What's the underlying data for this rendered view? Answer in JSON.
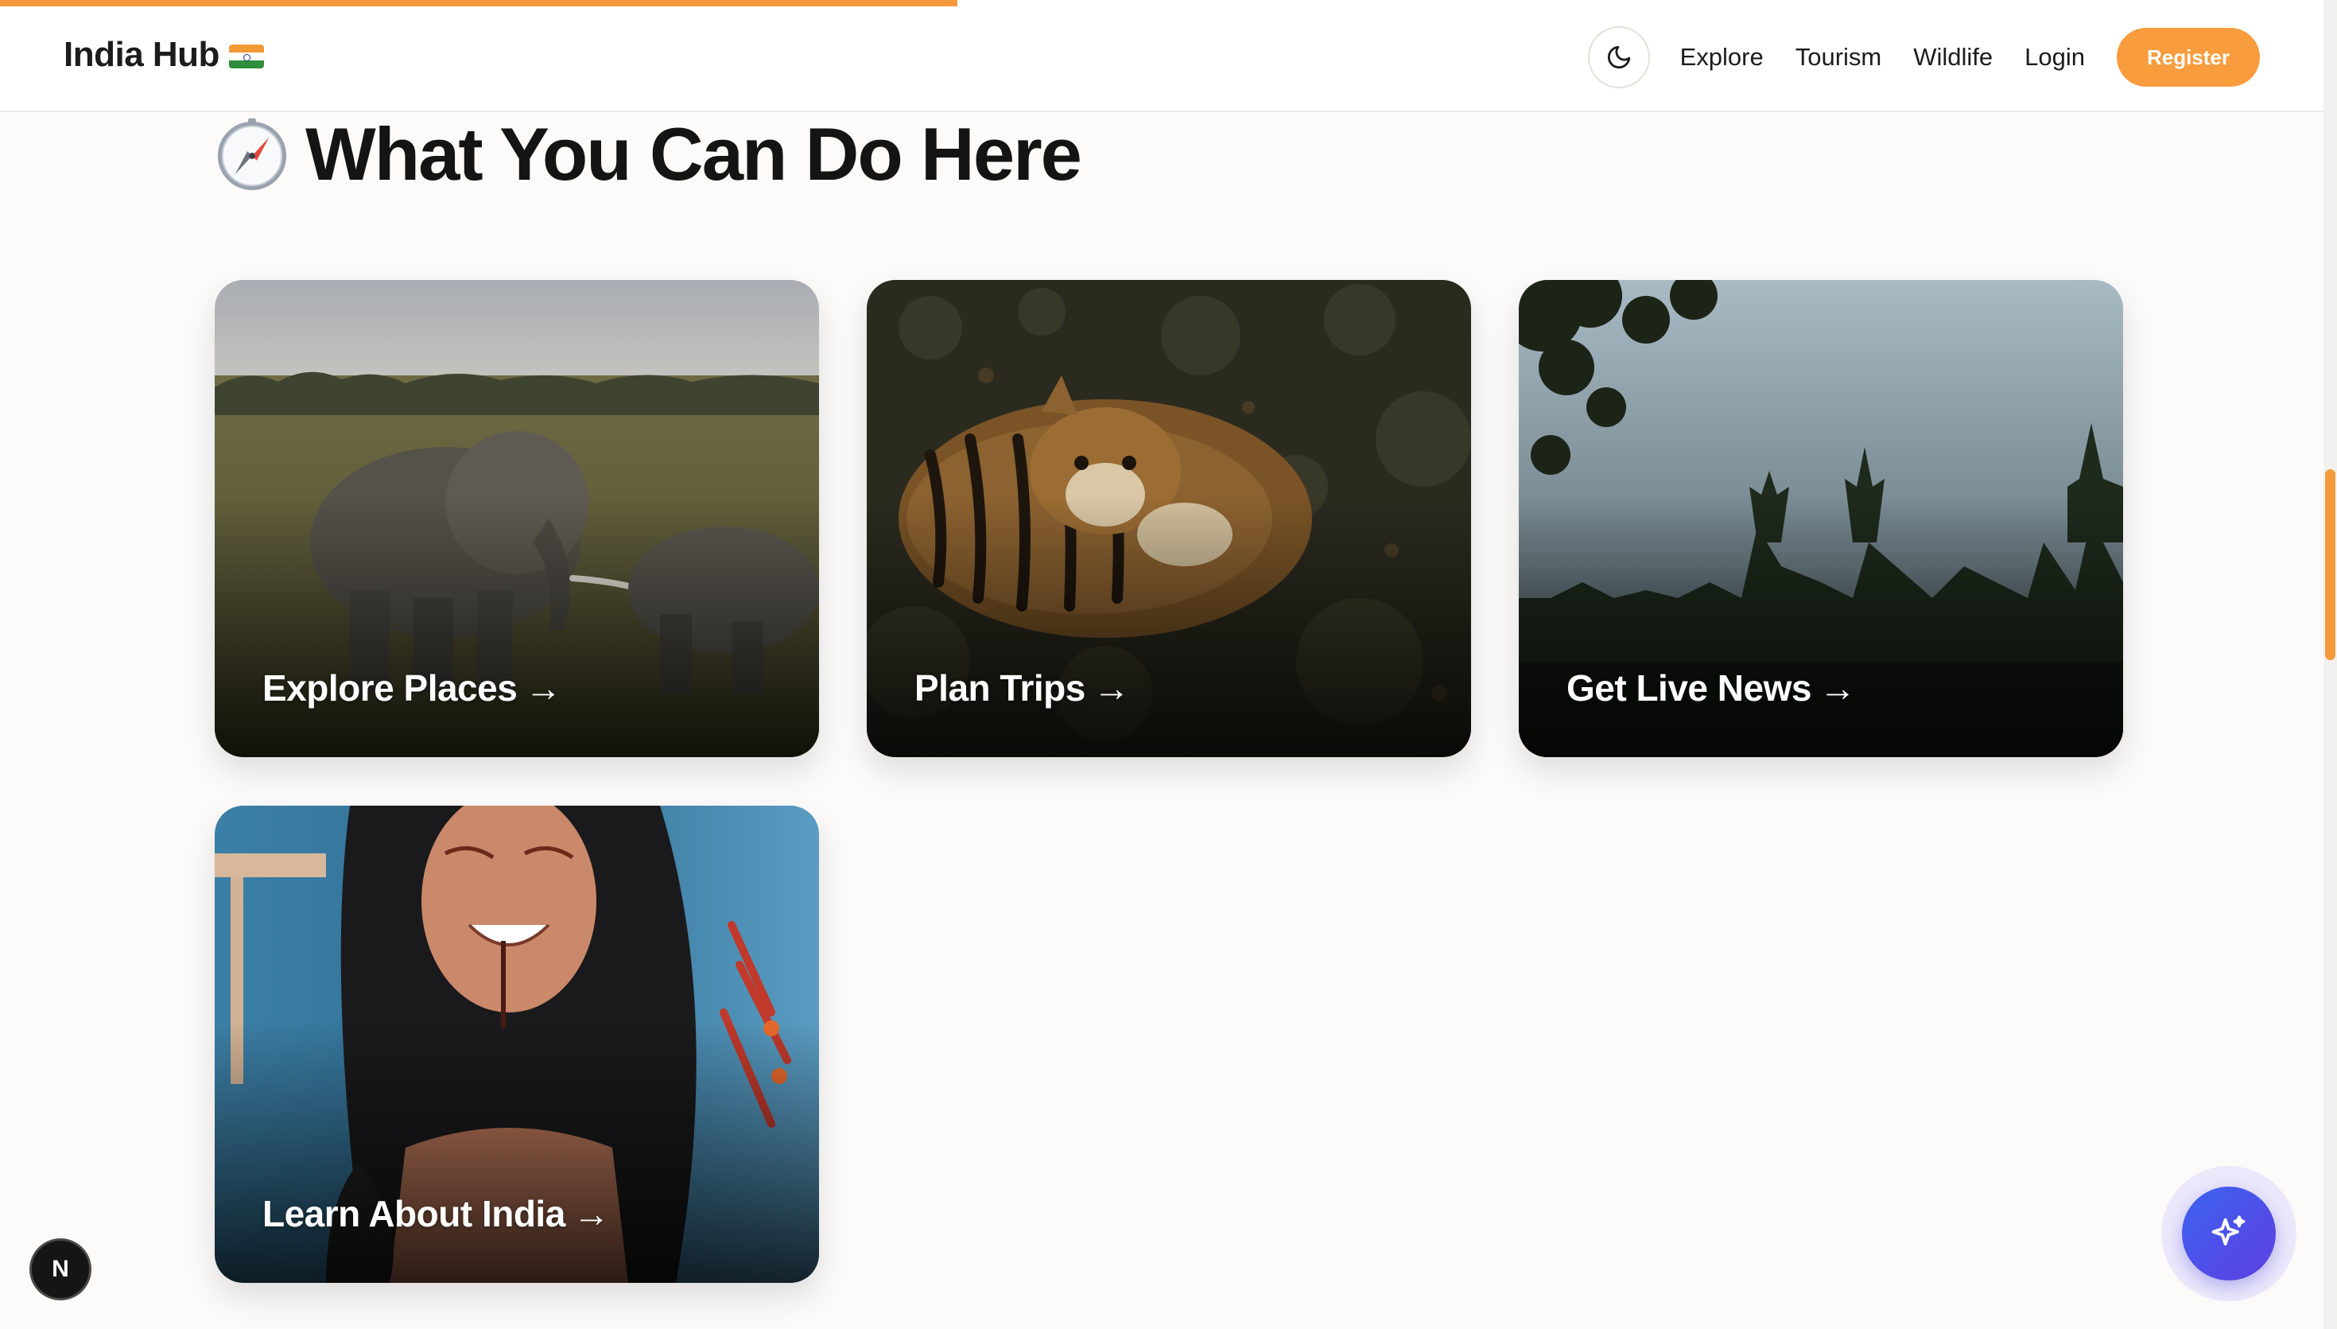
{
  "brand": {
    "name": "India Hub",
    "flag_icon": "india-flag-icon"
  },
  "progress": {
    "fraction": 0.412,
    "color": "#f59a3c"
  },
  "nav": {
    "theme_toggle_icon": "moon-icon",
    "links": [
      "Explore",
      "Tourism",
      "Wildlife",
      "Login"
    ],
    "register_label": "Register",
    "accent": "#f89c3d"
  },
  "section": {
    "icon": "compass-icon",
    "title": "What You Can Do Here"
  },
  "cards": [
    {
      "label": "Explore Places",
      "arrow": "→",
      "scene": "elephants-grassland"
    },
    {
      "label": "Plan Trips",
      "arrow": "→",
      "scene": "tiger-forest"
    },
    {
      "label": "Get Live News",
      "arrow": "→",
      "scene": "misty-trees"
    },
    {
      "label": "Learn About India",
      "arrow": "→",
      "scene": "portrait-feather-headdress"
    }
  ],
  "widgets": {
    "next_badge": "N",
    "ai_fab_icon": "sparkle-icon"
  }
}
